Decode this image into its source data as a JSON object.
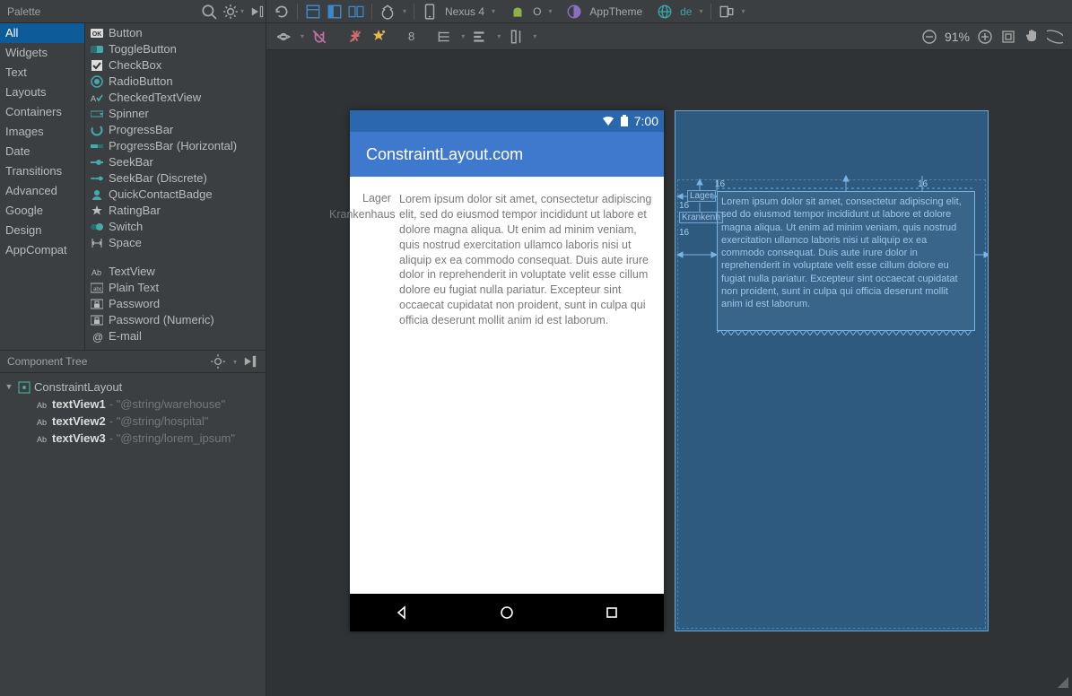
{
  "palette_title": "Palette",
  "toolbar": {
    "device": "Nexus 4",
    "theme": "AppTheme",
    "locale": "de",
    "android_api": "O"
  },
  "designbar": {
    "margin_value": "8",
    "zoom": "91%"
  },
  "categories": [
    "All",
    "Widgets",
    "Text",
    "Layouts",
    "Containers",
    "Images",
    "Date",
    "Transitions",
    "Advanced",
    "Google",
    "Design",
    "AppCompat"
  ],
  "widgets_group1": [
    {
      "icon": "ok",
      "label": "Button"
    },
    {
      "icon": "toggle",
      "label": "ToggleButton"
    },
    {
      "icon": "check",
      "label": "CheckBox"
    },
    {
      "icon": "radio",
      "label": "RadioButton"
    },
    {
      "icon": "checkedtv",
      "label": "CheckedTextView"
    },
    {
      "icon": "spinner",
      "label": "Spinner"
    },
    {
      "icon": "progress",
      "label": "ProgressBar"
    },
    {
      "icon": "progressh",
      "label": "ProgressBar (Horizontal)"
    },
    {
      "icon": "seek",
      "label": "SeekBar"
    },
    {
      "icon": "seekd",
      "label": "SeekBar (Discrete)"
    },
    {
      "icon": "quick",
      "label": "QuickContactBadge"
    },
    {
      "icon": "rating",
      "label": "RatingBar"
    },
    {
      "icon": "switch",
      "label": "Switch"
    },
    {
      "icon": "space",
      "label": "Space"
    }
  ],
  "widgets_group2": [
    {
      "icon": "textview",
      "label": "TextView"
    },
    {
      "icon": "plain",
      "label": "Plain Text"
    },
    {
      "icon": "pwd",
      "label": "Password"
    },
    {
      "icon": "pwdnum",
      "label": "Password (Numeric)"
    },
    {
      "icon": "email",
      "label": "E-mail"
    }
  ],
  "ctree": {
    "title": "Component Tree",
    "root": "ConstraintLayout",
    "items": [
      {
        "name": "textView1",
        "hint": "\"@string/warehouse\""
      },
      {
        "name": "textView2",
        "hint": "\"@string/hospital\""
      },
      {
        "name": "textView3",
        "hint": "\"@string/lorem_ipsum\""
      }
    ]
  },
  "preview": {
    "time": "7:00",
    "app_title": "ConstraintLayout.com",
    "label_lager": "Lager",
    "label_krank": "Krankenhaus",
    "lorem": "Lorem ipsum dolor sit amet, consectetur adipiscing elit, sed do eiusmod tempor incididunt ut labore et dolore magna aliqua. Ut enim ad minim veniam, quis nostrud exercitation ullamco laboris nisi ut aliquip ex ea commodo consequat. Duis aute irure dolor in reprehenderit in voluptate velit esse cillum dolore eu fugiat nulla pariatur. Excepteur sint occaecat cupidatat non proident, sunt in culpa qui officia deserunt mollit anim id est laborum."
  },
  "blueprint": {
    "lager": "Lager",
    "krank": "Krankenh",
    "m16": "16",
    "lorem": "Lorem ipsum dolor sit amet, consectetur adipiscing elit, sed do eiusmod tempor incididunt ut labore et dolore magna aliqua. Ut enim ad minim veniam, quis nostrud exercitation ullamco laboris nisi ut aliquip ex ea commodo consequat. Duis aute irure dolor in reprehenderit in voluptate velit esse cillum dolore eu fugiat nulla pariatur. Excepteur sint occaecat cupidatat non proident, sunt in culpa qui officia deserunt mollit anim id est laborum."
  }
}
